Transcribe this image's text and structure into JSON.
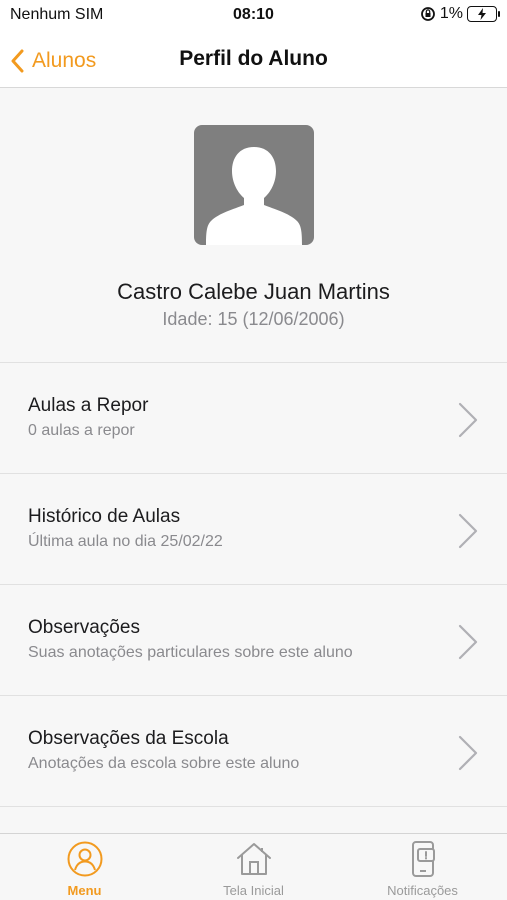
{
  "status_bar": {
    "carrier": "Nenhum SIM",
    "time": "08:10",
    "battery_percent": "1%",
    "icons": [
      "orientation-lock-icon",
      "battery-charging-icon"
    ]
  },
  "nav": {
    "back_label": "Alunos",
    "title": "Perfil do Aluno",
    "accent_color": "#f29a1f"
  },
  "profile": {
    "name": "Castro Calebe Juan Martins",
    "age_label": "Idade: 15 (12/06/2006)",
    "avatar_icon": "user-placeholder-icon"
  },
  "menu": {
    "items": [
      {
        "title": "Aulas a Repor",
        "subtitle": "0 aulas a repor"
      },
      {
        "title": "Histórico de Aulas",
        "subtitle": "Última aula no dia 25/02/22"
      },
      {
        "title": "Observações",
        "subtitle": "Suas anotações particulares sobre este aluno"
      },
      {
        "title": "Observações da Escola",
        "subtitle": "Anotações da escola sobre este aluno"
      }
    ]
  },
  "tab_bar": {
    "tabs": [
      {
        "label": "Menu",
        "icon": "user-circle-icon",
        "active": true
      },
      {
        "label": "Tela Inicial",
        "icon": "home-icon",
        "active": false
      },
      {
        "label": "Notificações",
        "icon": "phone-notification-icon",
        "active": false
      }
    ]
  }
}
